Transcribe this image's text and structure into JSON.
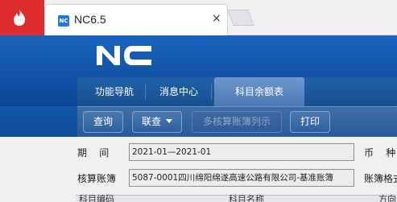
{
  "browser": {
    "tab_title": "NC6.5",
    "tab_favicon_text": "NC",
    "close_glyph": "×",
    "brand_color": "#df2d2f"
  },
  "app": {
    "logo_text": "NC",
    "header_color": "#1358ad"
  },
  "module_tabs": [
    {
      "label": "功能导航"
    },
    {
      "label": "消息中心"
    },
    {
      "label": "科目余额表",
      "active": true
    }
  ],
  "toolbar": {
    "query": "查询",
    "link_query": "联查",
    "multi_book": "多核算账簿列示",
    "print": "打印"
  },
  "form": {
    "period_label": "期    间",
    "period_value": "2021-01—2021-01",
    "currency_label": "币    种",
    "book_label": "核算账簿",
    "book_value": "5087-0001四川绵阳绵遂高速公路有限公司-基准账簿",
    "book_format_label": "账簿格式"
  },
  "grid": {
    "columns": [
      "科目编码",
      "科目名称",
      "方向"
    ]
  },
  "icons": {
    "app_badge": "flame-icon",
    "favicon": "nc-favicon-icon",
    "close": "close-icon",
    "new_tab": "new-tab-icon",
    "dropdown": "caret-down-icon"
  }
}
